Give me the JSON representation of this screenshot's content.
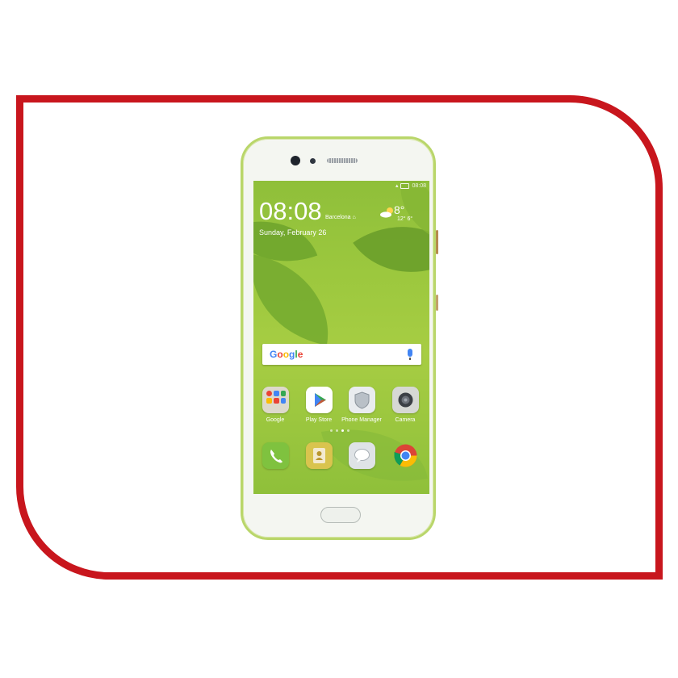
{
  "status_bar": {
    "time": "08:08"
  },
  "lock_widget": {
    "clock": "08:08",
    "city": "Barcelona",
    "date": "Sunday, February 26",
    "temperature": "8°",
    "temp_range": "12° 6°"
  },
  "search": {
    "brand": [
      "G",
      "o",
      "o",
      "g",
      "l",
      "e"
    ],
    "brand_colors": [
      "#4285f4",
      "#ea4335",
      "#fbbc05",
      "#4285f4",
      "#34a853",
      "#ea4335"
    ]
  },
  "apps": [
    {
      "label": "Google",
      "icon": "folder-icon"
    },
    {
      "label": "Play Store",
      "icon": "play-store-icon"
    },
    {
      "label": "Phone Manager",
      "icon": "shield-icon"
    },
    {
      "label": "Camera",
      "icon": "camera-icon"
    }
  ],
  "dock": [
    {
      "icon": "phone-icon"
    },
    {
      "icon": "contacts-icon"
    },
    {
      "icon": "messages-icon"
    },
    {
      "icon": "chrome-icon"
    }
  ],
  "colors": {
    "frame": "#c8161d",
    "phone_trim": "#b9d66a",
    "wallpaper": "#9cc83e"
  }
}
